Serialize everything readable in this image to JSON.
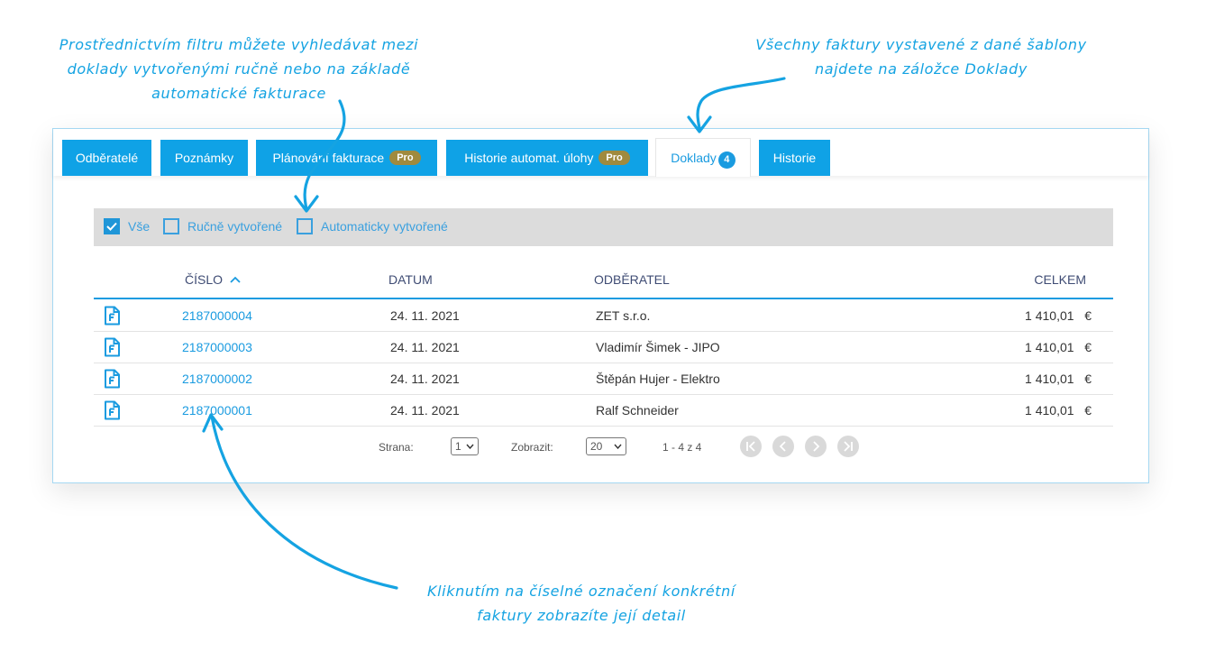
{
  "annotations": {
    "top_left": "Prostřednictvím filtru můžete vyhledávat mezi doklady vytvořenými ručně nebo na základě automatické fakturace",
    "top_right": "Všechny faktury vystavené z dané šablony najdete na záložce Doklady",
    "bottom": "Kliknutím na číselné označení konkrétní faktury zobrazíte její detail"
  },
  "tabs": [
    {
      "label": "Odběratelé"
    },
    {
      "label": "Poznámky"
    },
    {
      "label": "Plánování fakturace",
      "badge": "Pro"
    },
    {
      "label": "Historie automat. úlohy",
      "badge": "Pro"
    },
    {
      "label": "Doklady",
      "count": "4",
      "active": true
    },
    {
      "label": "Historie"
    }
  ],
  "filters": [
    {
      "label": "Vše",
      "checked": true
    },
    {
      "label": "Ručně vytvořené",
      "checked": false
    },
    {
      "label": "Automaticky vytvořené",
      "checked": false
    }
  ],
  "table": {
    "columns": {
      "number": "ČÍSLO",
      "date": "DATUM",
      "customer": "ODBĚRATEL",
      "total": "CELKEM"
    },
    "sort_icon": "chevron-up-icon",
    "rows": [
      {
        "icon": "invoice-file-icon",
        "number": "2187000004",
        "date": "24. 11. 2021",
        "customer": "ZET s.r.o.",
        "total": "1 410,01",
        "currency": "€"
      },
      {
        "icon": "invoice-file-icon",
        "number": "2187000003",
        "date": "24. 11. 2021",
        "customer": "Vladimír Šimek - JIPO",
        "total": "1 410,01",
        "currency": "€"
      },
      {
        "icon": "invoice-file-icon",
        "number": "2187000002",
        "date": "24. 11. 2021",
        "customer": "Štěpán Hujer - Elektro",
        "total": "1 410,01",
        "currency": "€"
      },
      {
        "icon": "invoice-file-icon",
        "number": "2187000001",
        "date": "24. 11. 2021",
        "customer": "Ralf Schneider",
        "total": "1 410,01",
        "currency": "€"
      }
    ]
  },
  "pager": {
    "page_label": "Strana:",
    "page_value": "1",
    "show_label": "Zobrazit:",
    "show_value": "20",
    "range": "1 - 4 z 4",
    "buttons": [
      "first-page-icon",
      "prev-page-icon",
      "next-page-icon",
      "last-page-icon"
    ]
  },
  "colors": {
    "accent": "#0fa2e6",
    "pro_badge": "#a08a3e",
    "filter_bg": "#dcdcdc",
    "header_text": "#3f4c74"
  }
}
